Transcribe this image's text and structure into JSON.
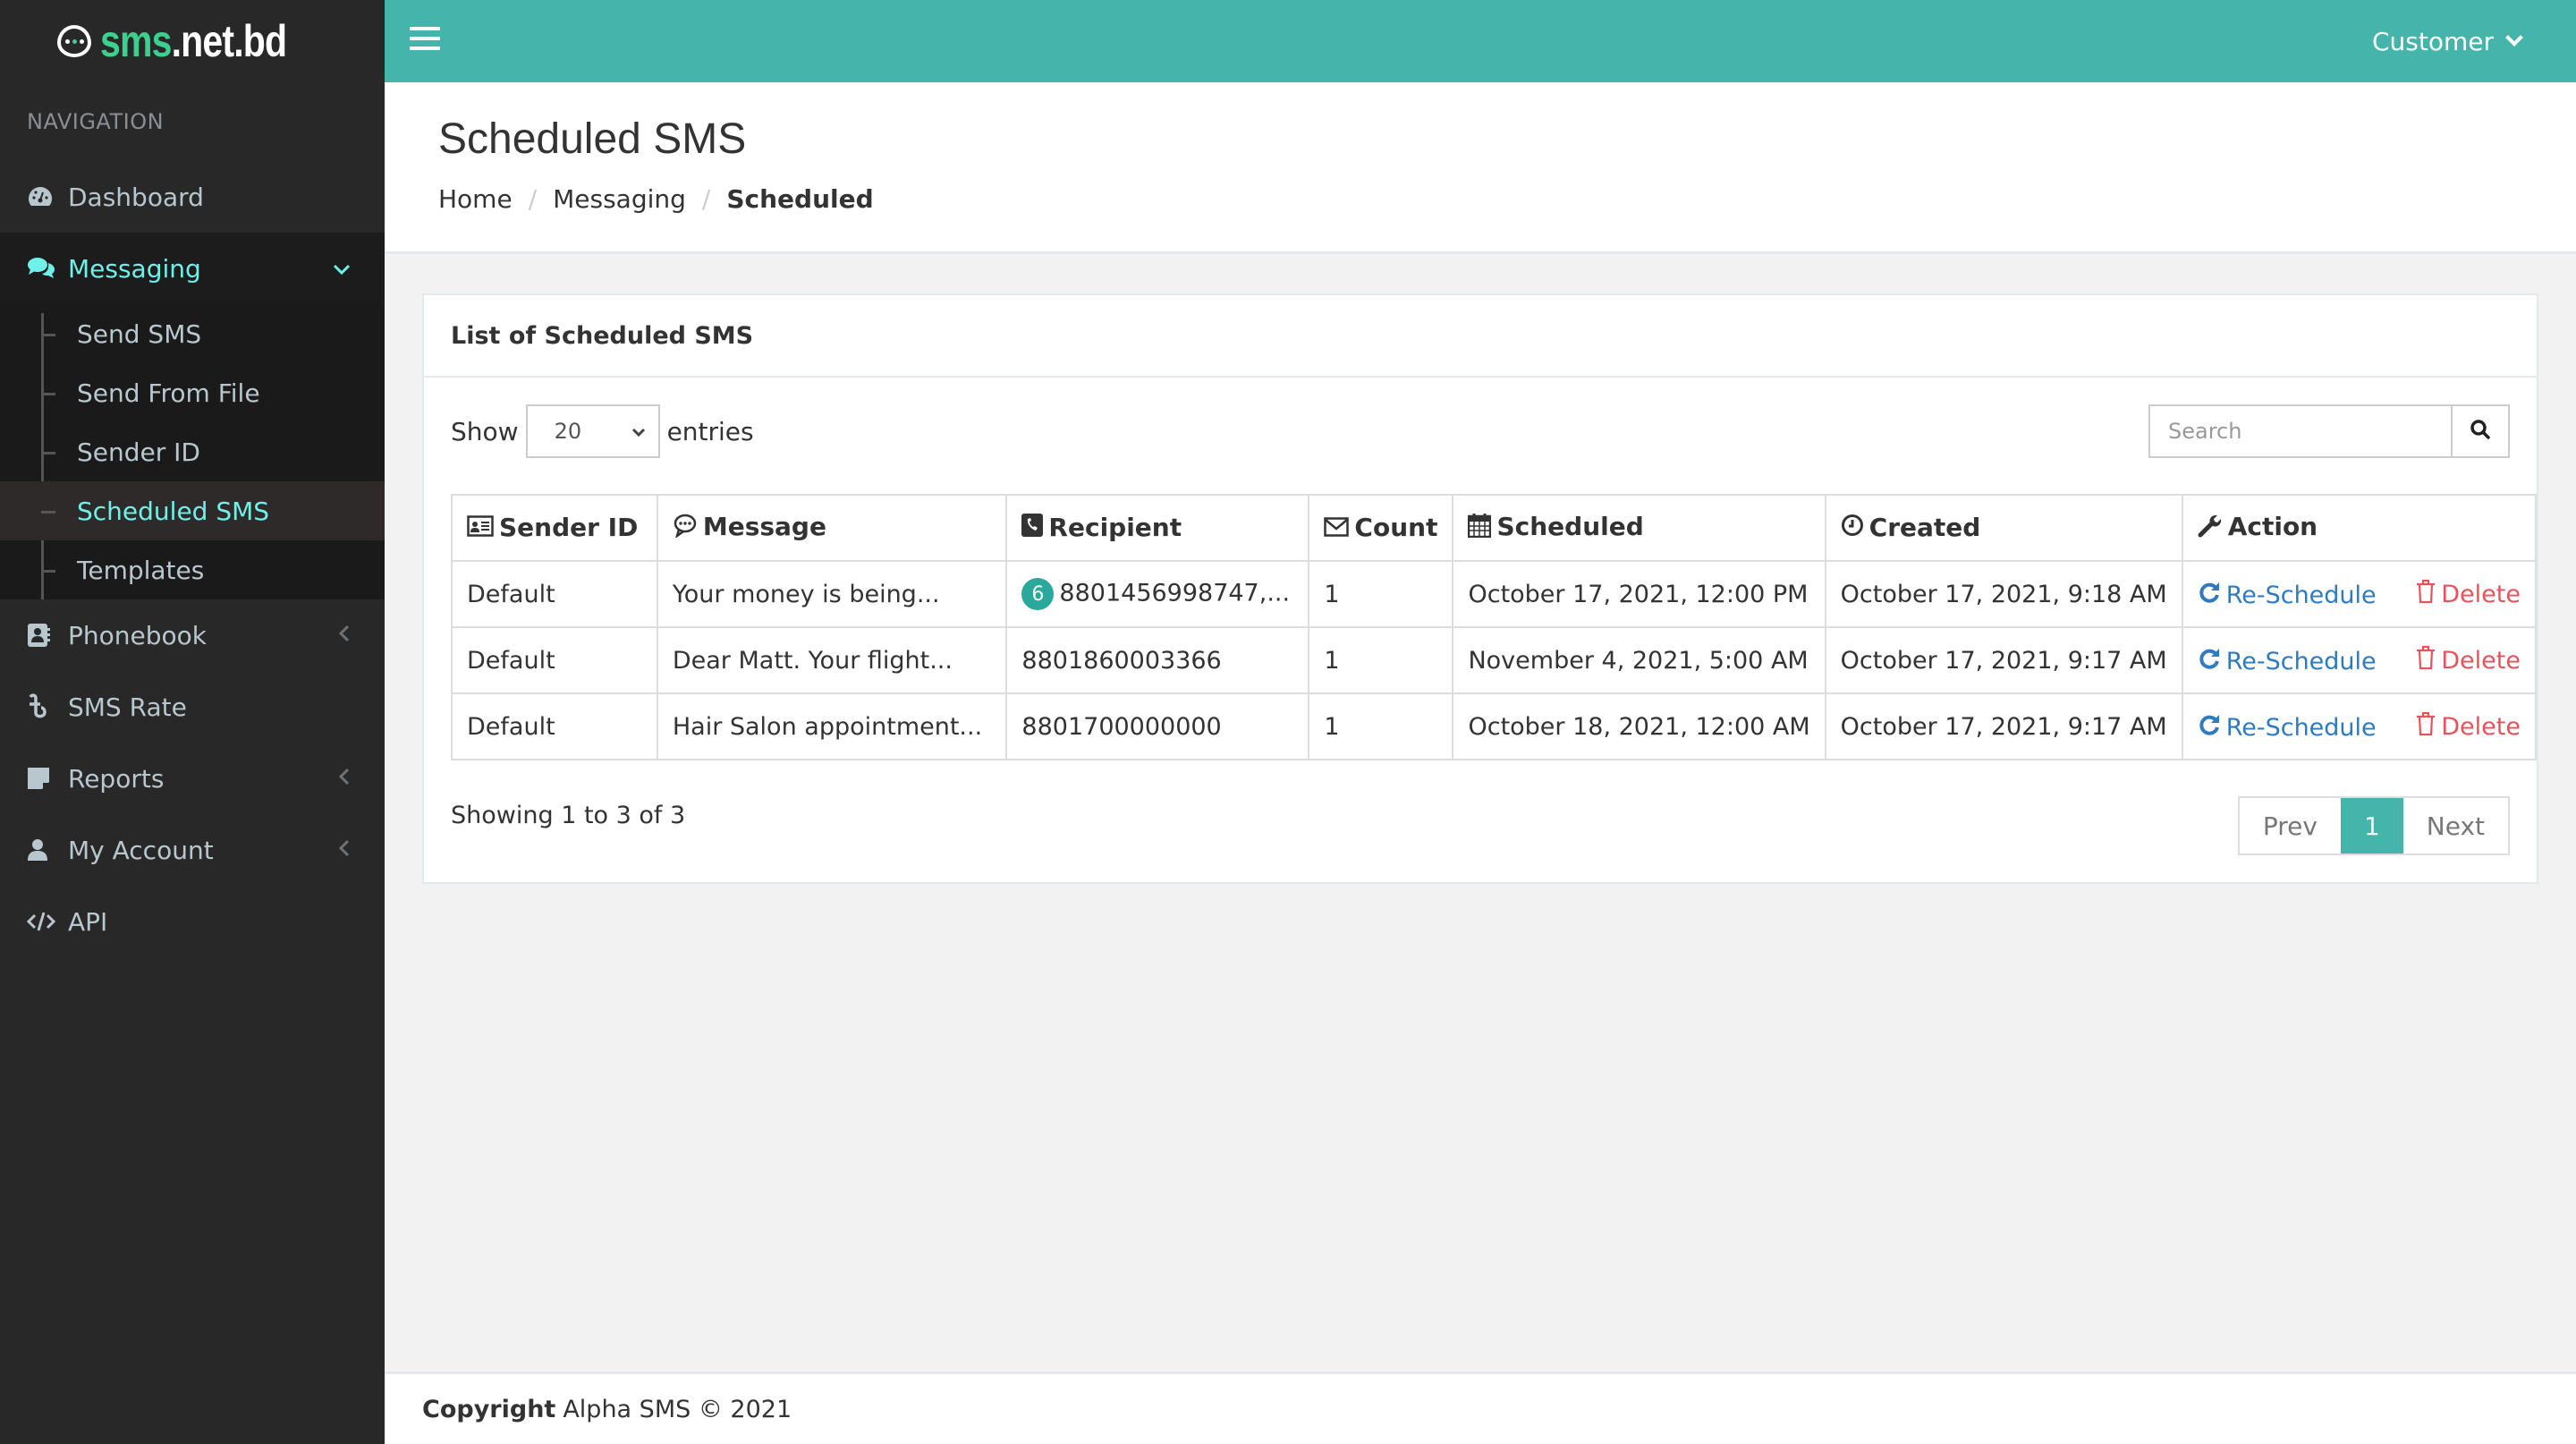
{
  "brand": {
    "logo_green": "sms",
    "logo_white": ".net.bd",
    "accent": "#45b5ab",
    "logo_green_color": "#3ecf8e"
  },
  "sidebar": {
    "nav_header": "NAVIGATION",
    "items": [
      {
        "label": "Dashboard",
        "icon": "dashboard-icon"
      },
      {
        "label": "Messaging",
        "icon": "comments-icon",
        "expanded": true,
        "children": [
          {
            "label": "Send SMS"
          },
          {
            "label": "Send From File"
          },
          {
            "label": "Sender ID"
          },
          {
            "label": "Scheduled SMS",
            "active": true
          },
          {
            "label": "Templates"
          }
        ]
      },
      {
        "label": "Phonebook",
        "icon": "address-book-icon"
      },
      {
        "label": "SMS Rate",
        "icon": "taka-icon"
      },
      {
        "label": "Reports",
        "icon": "sticky-note-icon"
      },
      {
        "label": "My Account",
        "icon": "user-icon"
      },
      {
        "label": "API",
        "icon": "code-icon"
      }
    ]
  },
  "topbar": {
    "user_menu": "Customer"
  },
  "header": {
    "title": "Scheduled SMS",
    "breadcrumb": [
      "Home",
      "Messaging",
      "Scheduled"
    ],
    "separator": "/"
  },
  "card": {
    "title": "List of Scheduled SMS",
    "show_label": "Show",
    "entries_label": "entries",
    "page_size": "20",
    "search_placeholder": "Search",
    "search_value": ""
  },
  "table": {
    "columns": [
      "Sender ID",
      "Message",
      "Recipient",
      "Count",
      "Scheduled",
      "Created",
      "Action"
    ],
    "rows": [
      {
        "sender": "Default",
        "message": "Your money is being...",
        "recipient_badge": "6",
        "recipient": "8801456998747,...",
        "count": "1",
        "scheduled": "October 17, 2021, 12:00 PM",
        "created": "October 17, 2021, 9:18 AM"
      },
      {
        "sender": "Default",
        "message": "Dear Matt. Your flight...",
        "recipient": "8801860003366",
        "count": "1",
        "scheduled": "November 4, 2021, 5:00 AM",
        "created": "October 17, 2021, 9:17 AM"
      },
      {
        "sender": "Default",
        "message": "Hair Salon appointment...",
        "recipient": "8801700000000",
        "count": "1",
        "scheduled": "October 18, 2021, 12:00 AM",
        "created": "October 17, 2021, 9:17 AM"
      }
    ],
    "actions": {
      "reschedule": "Re-Schedule",
      "delete": "Delete"
    }
  },
  "footer_info": {
    "showing": "Showing 1 to 3 of 3",
    "pagination": {
      "prev": "Prev",
      "current": "1",
      "next": "Next"
    }
  },
  "footer": {
    "copyright_label": "Copyright",
    "text": "Alpha SMS © 2021"
  }
}
